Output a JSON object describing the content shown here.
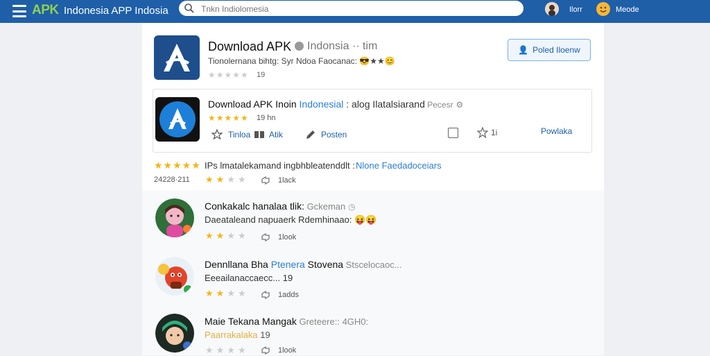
{
  "header": {
    "logo": "APK",
    "title": "Indonesia APP Indosia",
    "search_placeholder": "Tnkn Indiolomesia",
    "user1": "Ilorr",
    "user2": "Meode"
  },
  "app_main": {
    "title": "Download APK",
    "subtitle": "Indonsia ·· tim",
    "description": "Tionolernana bihtg: Syr Ndoa Faocanac: 😎★★😊",
    "stars": "★★★★★",
    "rating_count": "19",
    "follow_label": "Poled Iloenw"
  },
  "app_card": {
    "title_part1": "Download APK Inoin",
    "title_part2": " Indonesial",
    "title_part3": " : alog Ilatalsiarand",
    "title_part4": " Pecesr",
    "stars": "★★★★★",
    "rating_count": "19 hn",
    "action1": "Tinloa",
    "action2": "Atik",
    "action3": "Posten",
    "count": "1i",
    "link": "Powlaka"
  },
  "review": {
    "stars": "★★★★★",
    "text": "IPs lmatalekamand ingbhbleatenddlt :",
    "link": "Nlone Faedadoceiars",
    "date": "24228·211",
    "like_label": "1lack"
  },
  "comments": [
    {
      "name": "Conkakalc hanalaa tlik:",
      "meta": " Gckeman",
      "text": "Daeataleand napuaerk Rdemhinaao: 😝😝",
      "like_label": "1look"
    },
    {
      "name": "Dennllana Bha",
      "highlight": " Ptenera",
      "name2": " Stovena",
      "meta": " Stscelocaoc...",
      "text": "Eeeailanaccaecc...",
      "text_count": "19",
      "like_label": "1adds"
    },
    {
      "name": "Maie Tekana Mangak",
      "meta": " Greteere:: 4GH0:",
      "text": "Paarrakalaka",
      "text_count": "19",
      "like_label": "1look"
    }
  ]
}
